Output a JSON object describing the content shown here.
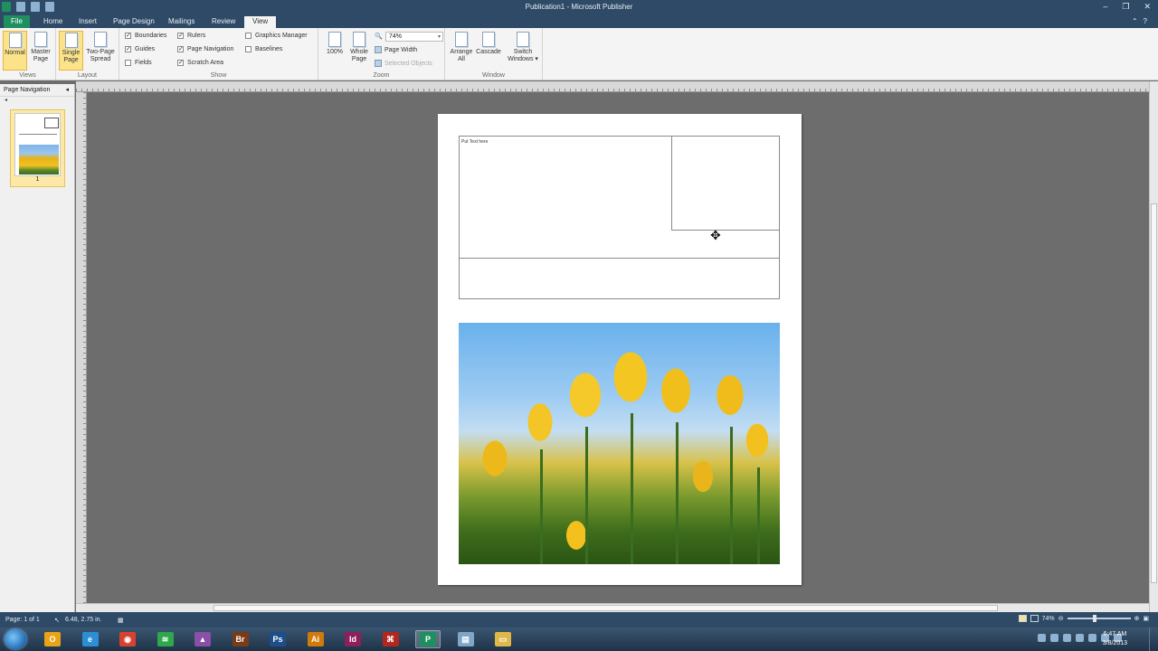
{
  "window": {
    "title": "Publication1 - Microsoft Publisher",
    "min": "–",
    "restore": "❐",
    "close": "✕"
  },
  "tabs": [
    {
      "label": "File"
    },
    {
      "label": "Home"
    },
    {
      "label": "Insert"
    },
    {
      "label": "Page Design"
    },
    {
      "label": "Mailings"
    },
    {
      "label": "Review"
    },
    {
      "label": "View"
    }
  ],
  "ribbon": {
    "views": {
      "label": "Views",
      "normal": "Normal",
      "master_page_1": "Master",
      "master_page_2": "Page"
    },
    "layout": {
      "label": "Layout",
      "single_page_1": "Single",
      "single_page_2": "Page",
      "two_page_1": "Two-Page",
      "two_page_2": "Spread"
    },
    "show": {
      "label": "Show",
      "boundaries": "Boundaries",
      "guides": "Guides",
      "fields": "Fields",
      "rulers": "Rulers",
      "page_navigation": "Page Navigation",
      "scratch_area": "Scratch Area",
      "graphics_manager": "Graphics Manager",
      "baselines": "Baselines",
      "check": "✓"
    },
    "zoom": {
      "label": "Zoom",
      "btn_100": "100%",
      "whole_page_1": "Whole",
      "whole_page_2": "Page",
      "zoom_value": "74%",
      "page_width": "Page Width",
      "selected_objects": "Selected Objects"
    },
    "window": {
      "label": "Window",
      "arrange_1": "Arrange",
      "arrange_2": "All",
      "cascade": "Cascade",
      "switch_1": "Switch",
      "switch_2": "Windows ▾"
    }
  },
  "nav": {
    "title": "Page Navigation",
    "collapse": "◂",
    "sub": "◂",
    "page_number": "1"
  },
  "page": {
    "placeholder_text": "Put Text here"
  },
  "status": {
    "page": "Page: 1 of 1",
    "position": "6.48, 2.75 in.",
    "zoom": "74%",
    "minus": "⊖",
    "plus": "⊕"
  },
  "taskbar": {
    "apps": [
      {
        "name": "Outlook",
        "glyph": "O",
        "color": "#e8a317"
      },
      {
        "name": "Internet Explorer",
        "glyph": "e",
        "color": "#2a8fd6"
      },
      {
        "name": "Chrome",
        "glyph": "◉",
        "color": "#d9412f"
      },
      {
        "name": "Spotify",
        "glyph": "≋",
        "color": "#2fa74b"
      },
      {
        "name": "Photos",
        "glyph": "▲",
        "color": "#8a4fa8"
      },
      {
        "name": "Bridge",
        "glyph": "Br",
        "color": "#7a3b16"
      },
      {
        "name": "Photoshop",
        "glyph": "Ps",
        "color": "#1d4e8c"
      },
      {
        "name": "Illustrator",
        "glyph": "Ai",
        "color": "#d07a0c"
      },
      {
        "name": "InDesign",
        "glyph": "Id",
        "color": "#8e1f5b"
      },
      {
        "name": "Acrobat",
        "glyph": "⌘",
        "color": "#b3261e"
      },
      {
        "name": "Publisher",
        "glyph": "P",
        "color": "#1f8f5f"
      },
      {
        "name": "Notepad",
        "glyph": "▤",
        "color": "#7fa6c8"
      },
      {
        "name": "Explorer",
        "glyph": "▭",
        "color": "#e0b84a"
      }
    ],
    "time": "6:47 AM",
    "date": "3/8/2013"
  }
}
